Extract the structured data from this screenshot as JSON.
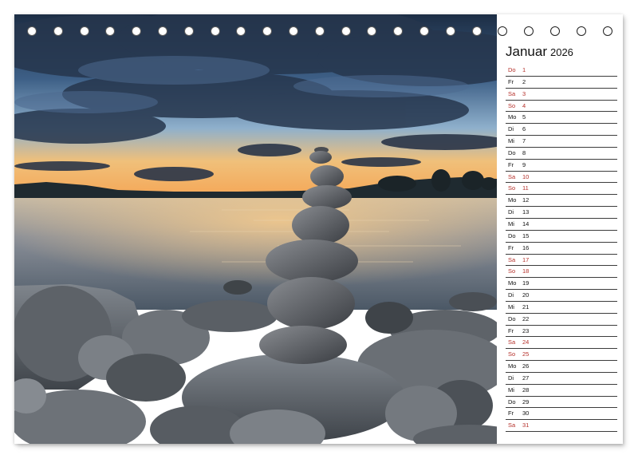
{
  "calendar": {
    "month": "Januar",
    "year": "2026",
    "days": [
      {
        "wd": "Do",
        "d": "1",
        "we": true
      },
      {
        "wd": "Fr",
        "d": "2",
        "we": false
      },
      {
        "wd": "Sa",
        "d": "3",
        "we": true
      },
      {
        "wd": "So",
        "d": "4",
        "we": true
      },
      {
        "wd": "Mo",
        "d": "5",
        "we": false
      },
      {
        "wd": "Di",
        "d": "6",
        "we": false
      },
      {
        "wd": "Mi",
        "d": "7",
        "we": false
      },
      {
        "wd": "Do",
        "d": "8",
        "we": false
      },
      {
        "wd": "Fr",
        "d": "9",
        "we": false
      },
      {
        "wd": "Sa",
        "d": "10",
        "we": true
      },
      {
        "wd": "So",
        "d": "11",
        "we": true
      },
      {
        "wd": "Mo",
        "d": "12",
        "we": false
      },
      {
        "wd": "Di",
        "d": "13",
        "we": false
      },
      {
        "wd": "Mi",
        "d": "14",
        "we": false
      },
      {
        "wd": "Do",
        "d": "15",
        "we": false
      },
      {
        "wd": "Fr",
        "d": "16",
        "we": false
      },
      {
        "wd": "Sa",
        "d": "17",
        "we": true
      },
      {
        "wd": "So",
        "d": "18",
        "we": true
      },
      {
        "wd": "Mo",
        "d": "19",
        "we": false
      },
      {
        "wd": "Di",
        "d": "20",
        "we": false
      },
      {
        "wd": "Mi",
        "d": "21",
        "we": false
      },
      {
        "wd": "Do",
        "d": "22",
        "we": false
      },
      {
        "wd": "Fr",
        "d": "23",
        "we": false
      },
      {
        "wd": "Sa",
        "d": "24",
        "we": true
      },
      {
        "wd": "So",
        "d": "25",
        "we": true
      },
      {
        "wd": "Mo",
        "d": "26",
        "we": false
      },
      {
        "wd": "Di",
        "d": "27",
        "we": false
      },
      {
        "wd": "Mi",
        "d": "28",
        "we": false
      },
      {
        "wd": "Do",
        "d": "29",
        "we": false
      },
      {
        "wd": "Fr",
        "d": "30",
        "we": false
      },
      {
        "wd": "Sa",
        "d": "31",
        "we": true
      }
    ]
  },
  "binding": {
    "ring_count": 23
  },
  "colors": {
    "weekend": "#b5302a",
    "text": "#111111",
    "rule": "#3c3c3c"
  },
  "photo": {
    "subject": "stacked-stones-at-lake-sunset"
  }
}
